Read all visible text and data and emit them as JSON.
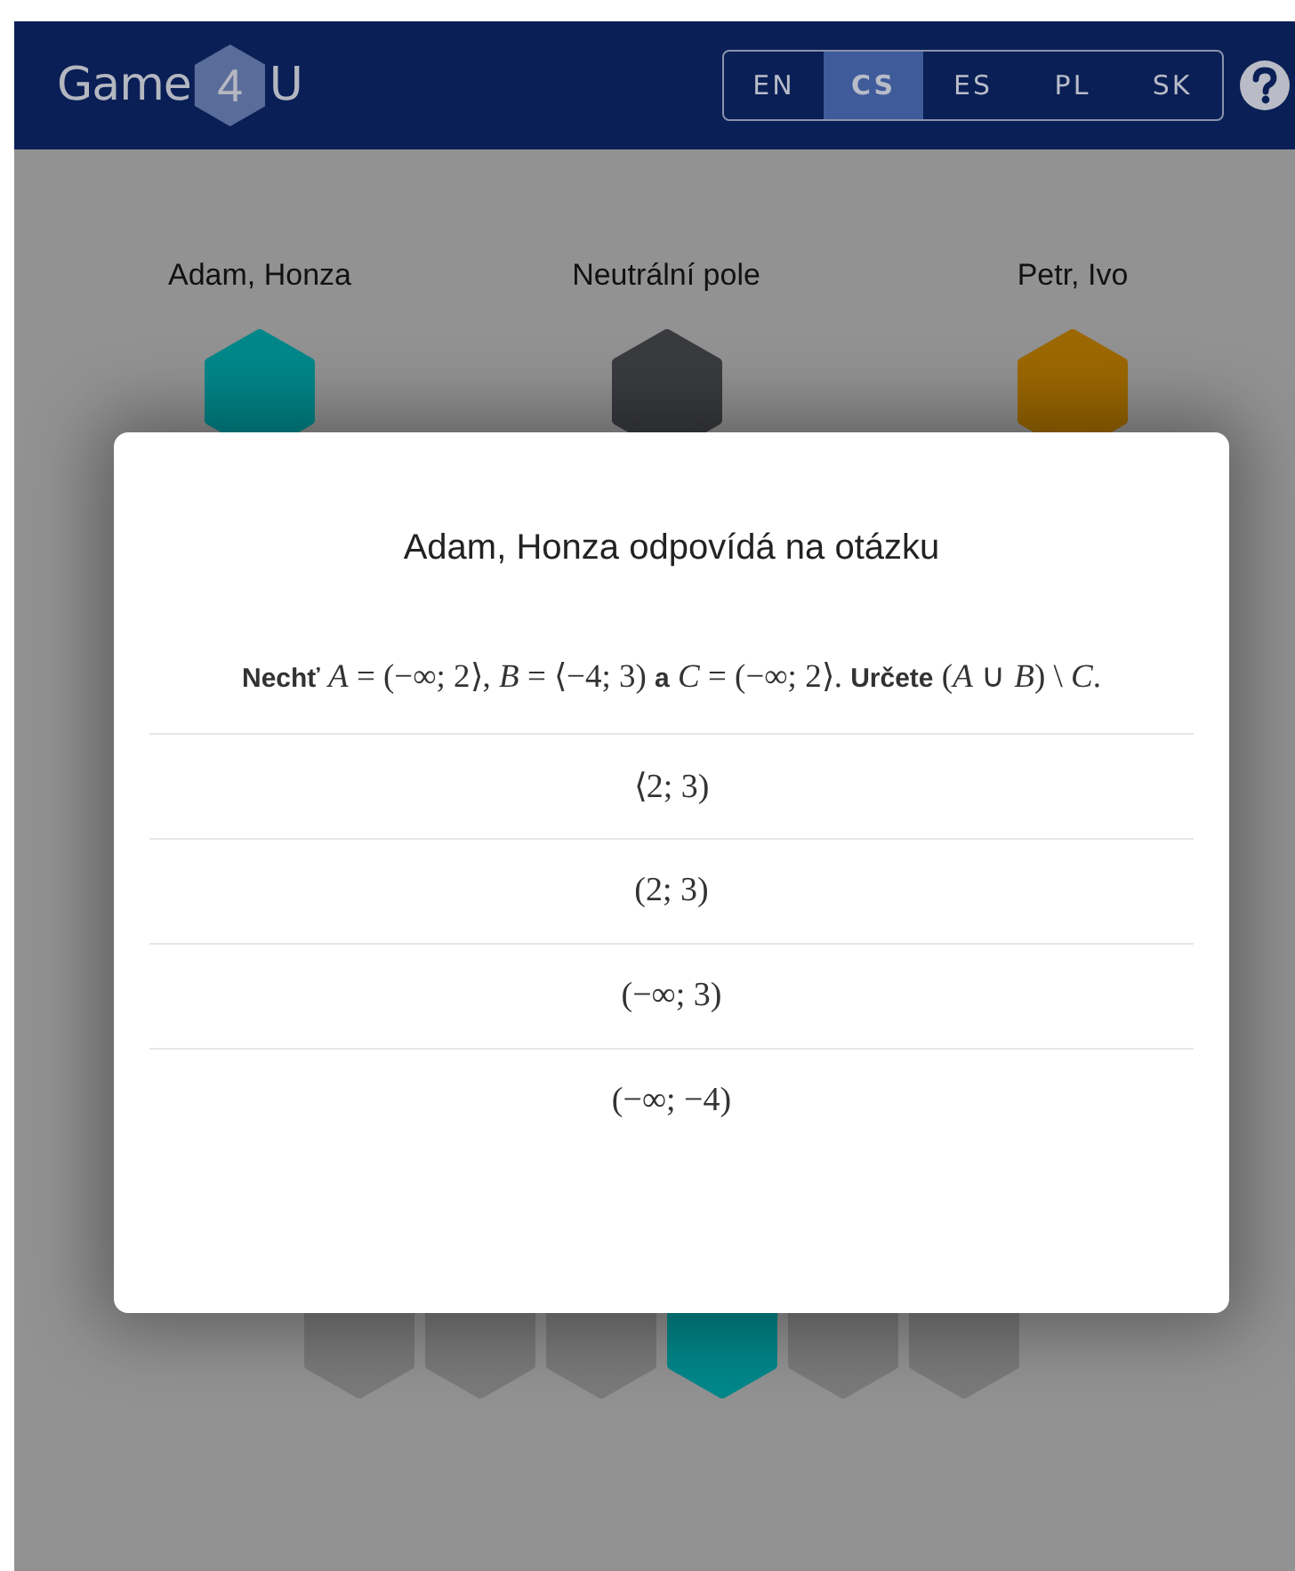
{
  "header": {
    "logo": {
      "left": "Game",
      "middle": "4",
      "right": "U"
    },
    "languages": [
      {
        "label": "EN",
        "selected": false
      },
      {
        "label": "CS",
        "selected": true
      },
      {
        "label": "ES",
        "selected": false
      },
      {
        "label": "PL",
        "selected": false
      },
      {
        "label": "SK",
        "selected": false
      }
    ]
  },
  "teams": [
    {
      "name": "Adam, Honza",
      "color": "#00878a"
    },
    {
      "name": "Neutrální pole",
      "color": "#3a3b3f"
    },
    {
      "name": "Petr, Ivo",
      "color": "#9c6800"
    }
  ],
  "board_tiles": [
    {
      "color": "#7a7a7a"
    },
    {
      "color": "#7a7a7a"
    },
    {
      "color": "#7a7a7a"
    },
    {
      "color": "#00878a"
    },
    {
      "color": "#7a7a7a"
    },
    {
      "color": "#7a7a7a"
    }
  ],
  "dialog": {
    "title": "Adam, Honza odpovídá na otázku",
    "question": "**Nechť** *A* = (−∞; 2⟩, *B* = ⟨−4; 3) **a** *C* = (−∞; 2⟩. **Určete** (*A* ∪ *B*) \\ *C*.",
    "answers": [
      "⟨2; 3)",
      "(2; 3)",
      "(−∞; 3)",
      "(−∞; −4)"
    ]
  }
}
